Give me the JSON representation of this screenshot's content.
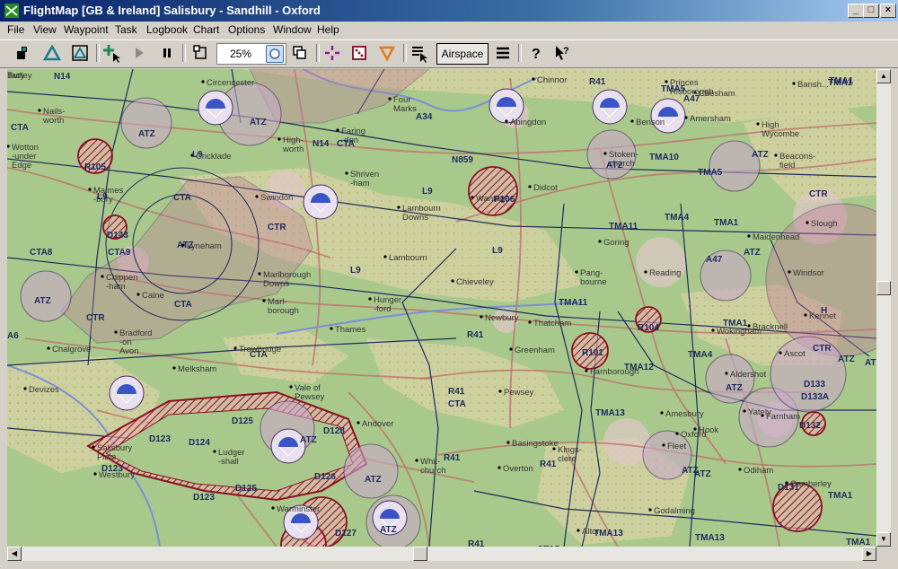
{
  "window": {
    "title": "FlightMap  [GB & Ireland]  Salisbury - Sandhill - Oxford",
    "minimize": "_",
    "maximize": "□",
    "close": "×"
  },
  "menu": [
    "File",
    "View",
    "Waypoint",
    "Task",
    "Logbook",
    "Chart",
    "Options",
    "Window",
    "Help"
  ],
  "toolbar": {
    "zoom_value": "25%",
    "airspace_label": "Airspace"
  },
  "map": {
    "places": [
      {
        "name": "Nails-\nworth"
      },
      {
        "name": "Wotton\n-under\nEdge"
      },
      {
        "name": "Circencester"
      },
      {
        "name": "Cricklade"
      },
      {
        "name": "High-\nworth"
      },
      {
        "name": "Faring\n-don"
      },
      {
        "name": "Malmes\n-bury"
      },
      {
        "name": "Shriven\n-ham"
      },
      {
        "name": "Swindon"
      },
      {
        "name": "Wantage"
      },
      {
        "name": "Didcot"
      },
      {
        "name": "Abingdon"
      },
      {
        "name": "Lambourn\nDowns"
      },
      {
        "name": "Lambourn"
      },
      {
        "name": "Chieveley"
      },
      {
        "name": "Lyneham"
      },
      {
        "name": "Chippen\n-ham"
      },
      {
        "name": "Calne"
      },
      {
        "name": "Marlborough\nDowns"
      },
      {
        "name": "Marl-\nborough"
      },
      {
        "name": "Hunger\n-ford"
      },
      {
        "name": "Newbury"
      },
      {
        "name": "Thatcham"
      },
      {
        "name": "Greenham"
      },
      {
        "name": "Goring"
      },
      {
        "name": "Pang-\nbourne"
      },
      {
        "name": "Reading"
      },
      {
        "name": "Wokingham"
      },
      {
        "name": "Bracknell"
      },
      {
        "name": "Maidenhead"
      },
      {
        "name": "Windsor"
      },
      {
        "name": "Slough"
      },
      {
        "name": "Beacons-\nfield"
      },
      {
        "name": "High\nWycombe"
      },
      {
        "name": "Amersham"
      },
      {
        "name": "Stoken-\nchurch"
      },
      {
        "name": "Benson"
      },
      {
        "name": "Chalgrove"
      },
      {
        "name": "Bradford\n-on\nAvon"
      },
      {
        "name": "Melksham"
      },
      {
        "name": "Devizes"
      },
      {
        "name": "Trowbridge"
      },
      {
        "name": "Vale of\nPewsey"
      },
      {
        "name": "Pewsey"
      },
      {
        "name": "Kings-\nclere"
      },
      {
        "name": "Basingstoke"
      },
      {
        "name": "Overton"
      },
      {
        "name": "Whit-\nchurch"
      },
      {
        "name": "Andover"
      },
      {
        "name": "Ludger\n-shall"
      },
      {
        "name": "Salisbury\nPlain"
      },
      {
        "name": "Westbury"
      },
      {
        "name": "Warminster"
      },
      {
        "name": "Amesbury"
      },
      {
        "name": "Hook"
      },
      {
        "name": "Fleet"
      },
      {
        "name": "Odiham"
      },
      {
        "name": "Farnham"
      },
      {
        "name": "Aldershot"
      },
      {
        "name": "Camberley"
      },
      {
        "name": "Godalming"
      },
      {
        "name": "Alton"
      },
      {
        "name": "Four\nMarks"
      },
      {
        "name": "Thames"
      },
      {
        "name": "Kennet"
      },
      {
        "name": "Ascot"
      },
      {
        "name": "Bansh..."
      },
      {
        "name": "Chesham"
      },
      {
        "name": "Princes\nRisborough"
      },
      {
        "name": "Chinnor"
      },
      {
        "name": "Oxford"
      },
      {
        "name": "Yately"
      },
      {
        "name": "Farnborough"
      },
      {
        "name": "Tadley"
      },
      {
        "name": "Bury"
      }
    ],
    "airspace_labels": [
      {
        "t": "N14"
      },
      {
        "t": "CTA"
      },
      {
        "t": "ATZ"
      },
      {
        "t": "ATZ"
      },
      {
        "t": "N14"
      },
      {
        "t": "CTA"
      },
      {
        "t": "A34"
      },
      {
        "t": "R41"
      },
      {
        "t": "TMA5"
      },
      {
        "t": "A47"
      },
      {
        "t": "TMA1"
      },
      {
        "t": "R105"
      },
      {
        "t": "L9"
      },
      {
        "t": "L9"
      },
      {
        "t": "N859"
      },
      {
        "t": "ATZ"
      },
      {
        "t": "TMA10"
      },
      {
        "t": "TMA5"
      },
      {
        "t": "ATZ"
      },
      {
        "t": "CTA"
      },
      {
        "t": "L9"
      },
      {
        "t": "P106"
      },
      {
        "t": "CTR"
      },
      {
        "t": "TMA11"
      },
      {
        "t": "TMA4"
      },
      {
        "t": "TMA1"
      },
      {
        "t": "CTR"
      },
      {
        "t": "D143"
      },
      {
        "t": "CTA9"
      },
      {
        "t": "CTA8"
      },
      {
        "t": "ATZ"
      },
      {
        "t": "L9"
      },
      {
        "t": "ATZ"
      },
      {
        "t": "A47"
      },
      {
        "t": "L9"
      },
      {
        "t": "TMA11"
      },
      {
        "t": "ATZ"
      },
      {
        "t": "CTR"
      },
      {
        "t": "CTA"
      },
      {
        "t": "A6"
      },
      {
        "t": "R41"
      },
      {
        "t": "TMA1"
      },
      {
        "t": "R104"
      },
      {
        "t": "CTR"
      },
      {
        "t": "TMA4"
      },
      {
        "t": "CTA"
      },
      {
        "t": "R101"
      },
      {
        "t": "TMA12"
      },
      {
        "t": "ATZ"
      },
      {
        "t": "D133"
      },
      {
        "t": "D133A"
      },
      {
        "t": "AT"
      },
      {
        "t": "R41"
      },
      {
        "t": "CTA"
      },
      {
        "t": "TMA13"
      },
      {
        "t": "ATZ"
      },
      {
        "t": "D125"
      },
      {
        "t": "D128"
      },
      {
        "t": "ATZ"
      },
      {
        "t": "D132"
      },
      {
        "t": "D123"
      },
      {
        "t": "D124"
      },
      {
        "t": "R41"
      },
      {
        "t": "D123"
      },
      {
        "t": "D126"
      },
      {
        "t": "ATZ"
      },
      {
        "t": "R41"
      },
      {
        "t": "ATZ"
      },
      {
        "t": "D123"
      },
      {
        "t": "D125"
      },
      {
        "t": "D127"
      },
      {
        "t": "ATZ"
      },
      {
        "t": "TMA13"
      },
      {
        "t": "TMA13"
      },
      {
        "t": "D131"
      },
      {
        "t": "TMA1"
      },
      {
        "t": "TMA1"
      },
      {
        "t": "R41"
      },
      {
        "t": "CTA5"
      },
      {
        "t": "TMA1"
      },
      {
        "t": "H"
      },
      {
        "t": "ATZ"
      }
    ]
  },
  "colors": {
    "terrain_low": "#a9c98c",
    "terrain_high": "#d8d2a4",
    "water": "#7a8fd8",
    "road": "#c06a6a",
    "airway": "#1e2a5e",
    "atz_fill": "#c9a9c9",
    "danger": "#8a1020",
    "parachute": "#3a54c8"
  }
}
